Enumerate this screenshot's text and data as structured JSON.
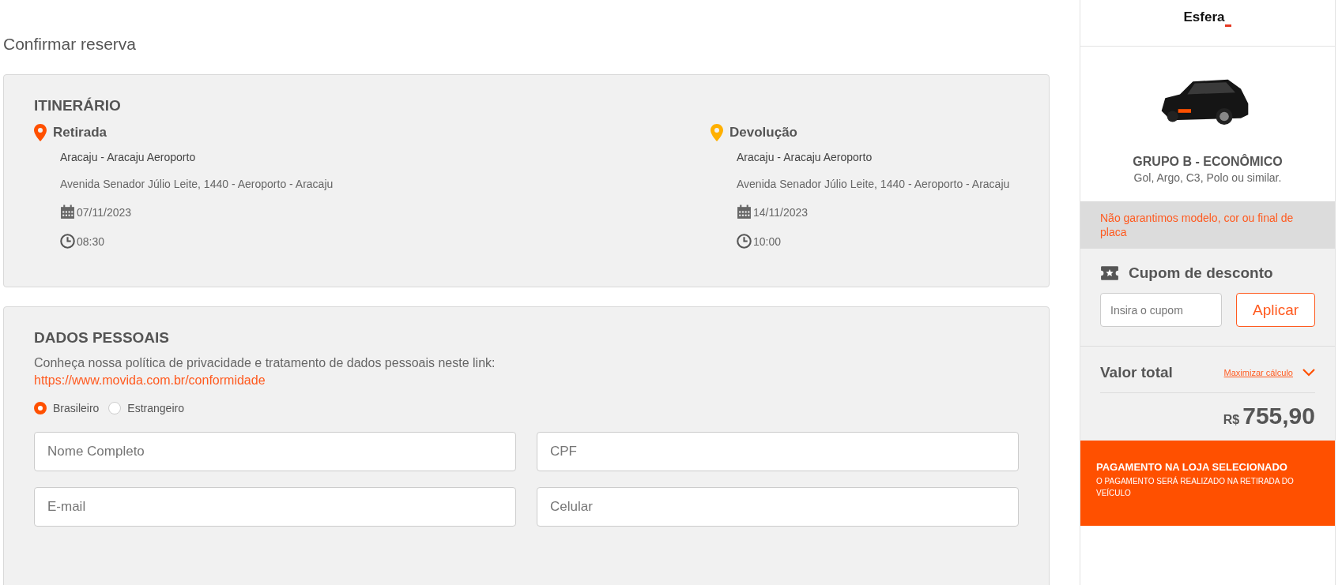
{
  "page_title": "Confirmar reserva",
  "itinerary": {
    "heading": "ITINERÁRIO",
    "stops": [
      {
        "label": "Retirada",
        "color": "#ff5000",
        "branch": "Aracaju - Aracaju Aeroporto",
        "address": "Avenida Senador Júlio Leite, 1440 - Aeroporto - Aracaju",
        "date": "07/11/2023",
        "time": "08:30"
      },
      {
        "label": "Devolução",
        "color": "#ffb000",
        "branch": "Aracaju - Aracaju Aeroporto",
        "address": "Avenida Senador Júlio Leite, 1440 - Aeroporto - Aracaju",
        "date": "14/11/2023",
        "time": "10:00"
      }
    ]
  },
  "personal": {
    "heading": "DADOS PESSOAIS",
    "privacy_text": "Conheça nossa política de privacidade e tratamento de dados pessoais neste link:",
    "privacy_link": "https://www.movida.com.br/conformidade",
    "nationality": [
      {
        "label": "Brasileiro",
        "selected": true
      },
      {
        "label": "Estrangeiro",
        "selected": false
      }
    ],
    "fields": [
      {
        "placeholder": "Nome Completo"
      },
      {
        "placeholder": "CPF"
      },
      {
        "placeholder": "E-mail"
      },
      {
        "placeholder": "Celular"
      }
    ]
  },
  "sidebar": {
    "logo": "Esfera",
    "car_group": "GRUPO B - ECONÔMICO",
    "car_models": "Gol, Argo, C3, Polo ou similar.",
    "notice": "Não garantimos modelo, cor ou final de placa",
    "coupon": {
      "title": "Cupom de desconto",
      "placeholder": "Insira o cupom",
      "button": "Aplicar"
    },
    "total": {
      "label": "Valor total",
      "expand_link": "Maximizar cálculo",
      "currency": "R$",
      "amount": "755,90"
    },
    "payment": {
      "title": "PAGAMENTO NA LOJA SELECIONADO",
      "subtitle": "O PAGAMENTO SERÁ REALIZADO NA RETIRADA DO VEÍCULO"
    }
  }
}
